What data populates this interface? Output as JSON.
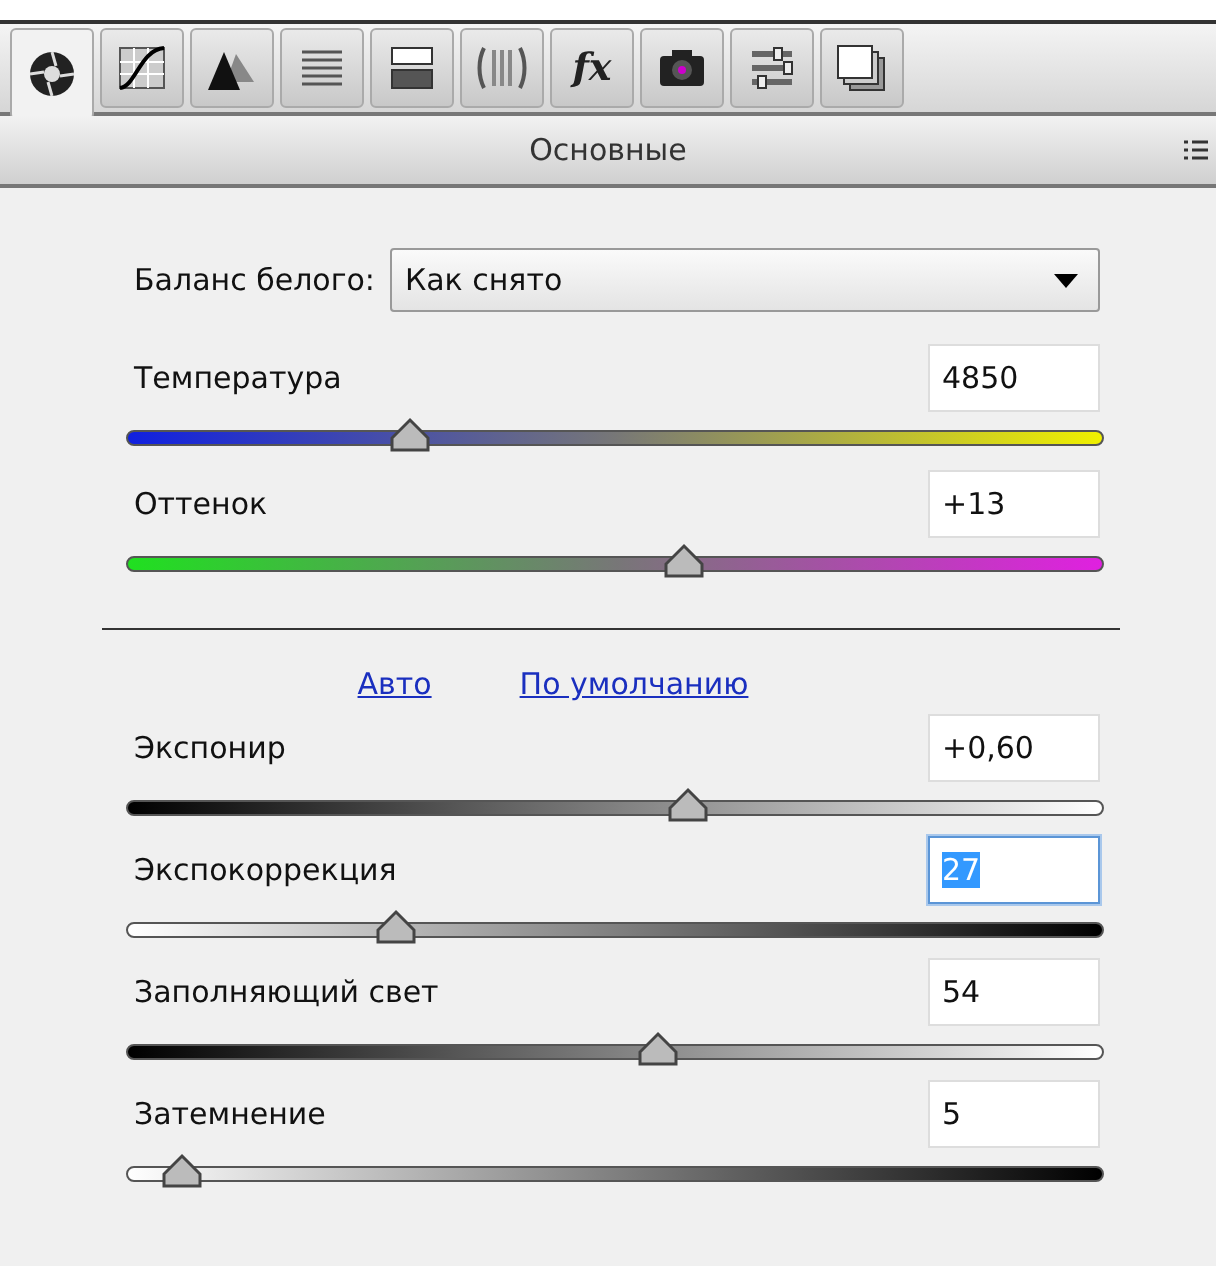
{
  "tabs": [
    {
      "selected": true
    },
    {
      "selected": false
    },
    {
      "selected": false
    },
    {
      "selected": false
    },
    {
      "selected": false
    },
    {
      "selected": false
    },
    {
      "label": "fx",
      "selected": false
    },
    {
      "selected": false
    },
    {
      "selected": false
    },
    {
      "selected": false
    }
  ],
  "panel": {
    "title": "Основные"
  },
  "white_balance": {
    "label": "Баланс белого:",
    "value": "Как снято"
  },
  "white_sliders": [
    {
      "label": "Температура",
      "value": "4850",
      "level": 0.29,
      "focused": false
    },
    {
      "label": "Оттенок",
      "value": "+13",
      "level": 0.57,
      "focused": false
    }
  ],
  "links": [
    "Авто",
    "По умолчанию"
  ],
  "tone_sliders": [
    {
      "label": "Экспонир",
      "value": "+0,60",
      "level": 0.575,
      "focused": false
    },
    {
      "label": "Экспокоррекция",
      "value": "27",
      "level": 0.275,
      "focused": true
    },
    {
      "label": "Заполняющий свет",
      "value": "54",
      "level": 0.545,
      "focused": false
    },
    {
      "label": "Затемнение",
      "value": "5",
      "level": 0.055,
      "focused": false
    }
  ]
}
